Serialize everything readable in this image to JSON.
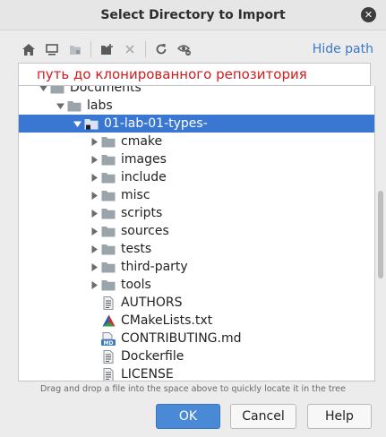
{
  "dialog": {
    "title": "Select Directory to Import"
  },
  "toolbar": {
    "icons": [
      "home-icon",
      "desktop-icon",
      "project-icon",
      "new-folder-icon",
      "delete-icon",
      "refresh-icon",
      "show-hidden-icon"
    ],
    "hide_path_label": "Hide path"
  },
  "path_field": {
    "value": "путь до клонированного репозитория"
  },
  "tree": {
    "rows": [
      {
        "label": "Documents",
        "type": "folder",
        "level": 0,
        "expanded": true
      },
      {
        "label": "labs",
        "type": "folder",
        "level": 1,
        "expanded": true
      },
      {
        "label": "01-lab-01-types-",
        "type": "module-folder",
        "level": 2,
        "expanded": true,
        "selected": true
      },
      {
        "label": "cmake",
        "type": "folder",
        "level": 3,
        "expanded": false
      },
      {
        "label": "images",
        "type": "folder",
        "level": 3,
        "expanded": false
      },
      {
        "label": "include",
        "type": "folder",
        "level": 3,
        "expanded": false
      },
      {
        "label": "misc",
        "type": "folder",
        "level": 3,
        "expanded": false
      },
      {
        "label": "scripts",
        "type": "folder",
        "level": 3,
        "expanded": false
      },
      {
        "label": "sources",
        "type": "folder",
        "level": 3,
        "expanded": false
      },
      {
        "label": "tests",
        "type": "folder",
        "level": 3,
        "expanded": false
      },
      {
        "label": "third-party",
        "type": "folder",
        "level": 3,
        "expanded": false
      },
      {
        "label": "tools",
        "type": "folder",
        "level": 3,
        "expanded": false
      },
      {
        "label": "AUTHORS",
        "type": "text-file",
        "level": 3
      },
      {
        "label": "CMakeLists.txt",
        "type": "cmake-file",
        "level": 3
      },
      {
        "label": "CONTRIBUTING.md",
        "type": "md-file",
        "level": 3
      },
      {
        "label": "Dockerfile",
        "type": "text-file",
        "level": 3
      },
      {
        "label": "LICENSE",
        "type": "text-file",
        "level": 3
      }
    ]
  },
  "hint": {
    "text": "Drag and drop a file into the space above to quickly locate it in the tree"
  },
  "buttons": {
    "ok": "OK",
    "cancel": "Cancel",
    "help": "Help"
  },
  "colors": {
    "selection": "#3a77d2",
    "link": "#3a78c9",
    "path_text": "#d11d1d",
    "ok_button": "#4a89d6",
    "folder": "#9aa4ab"
  }
}
